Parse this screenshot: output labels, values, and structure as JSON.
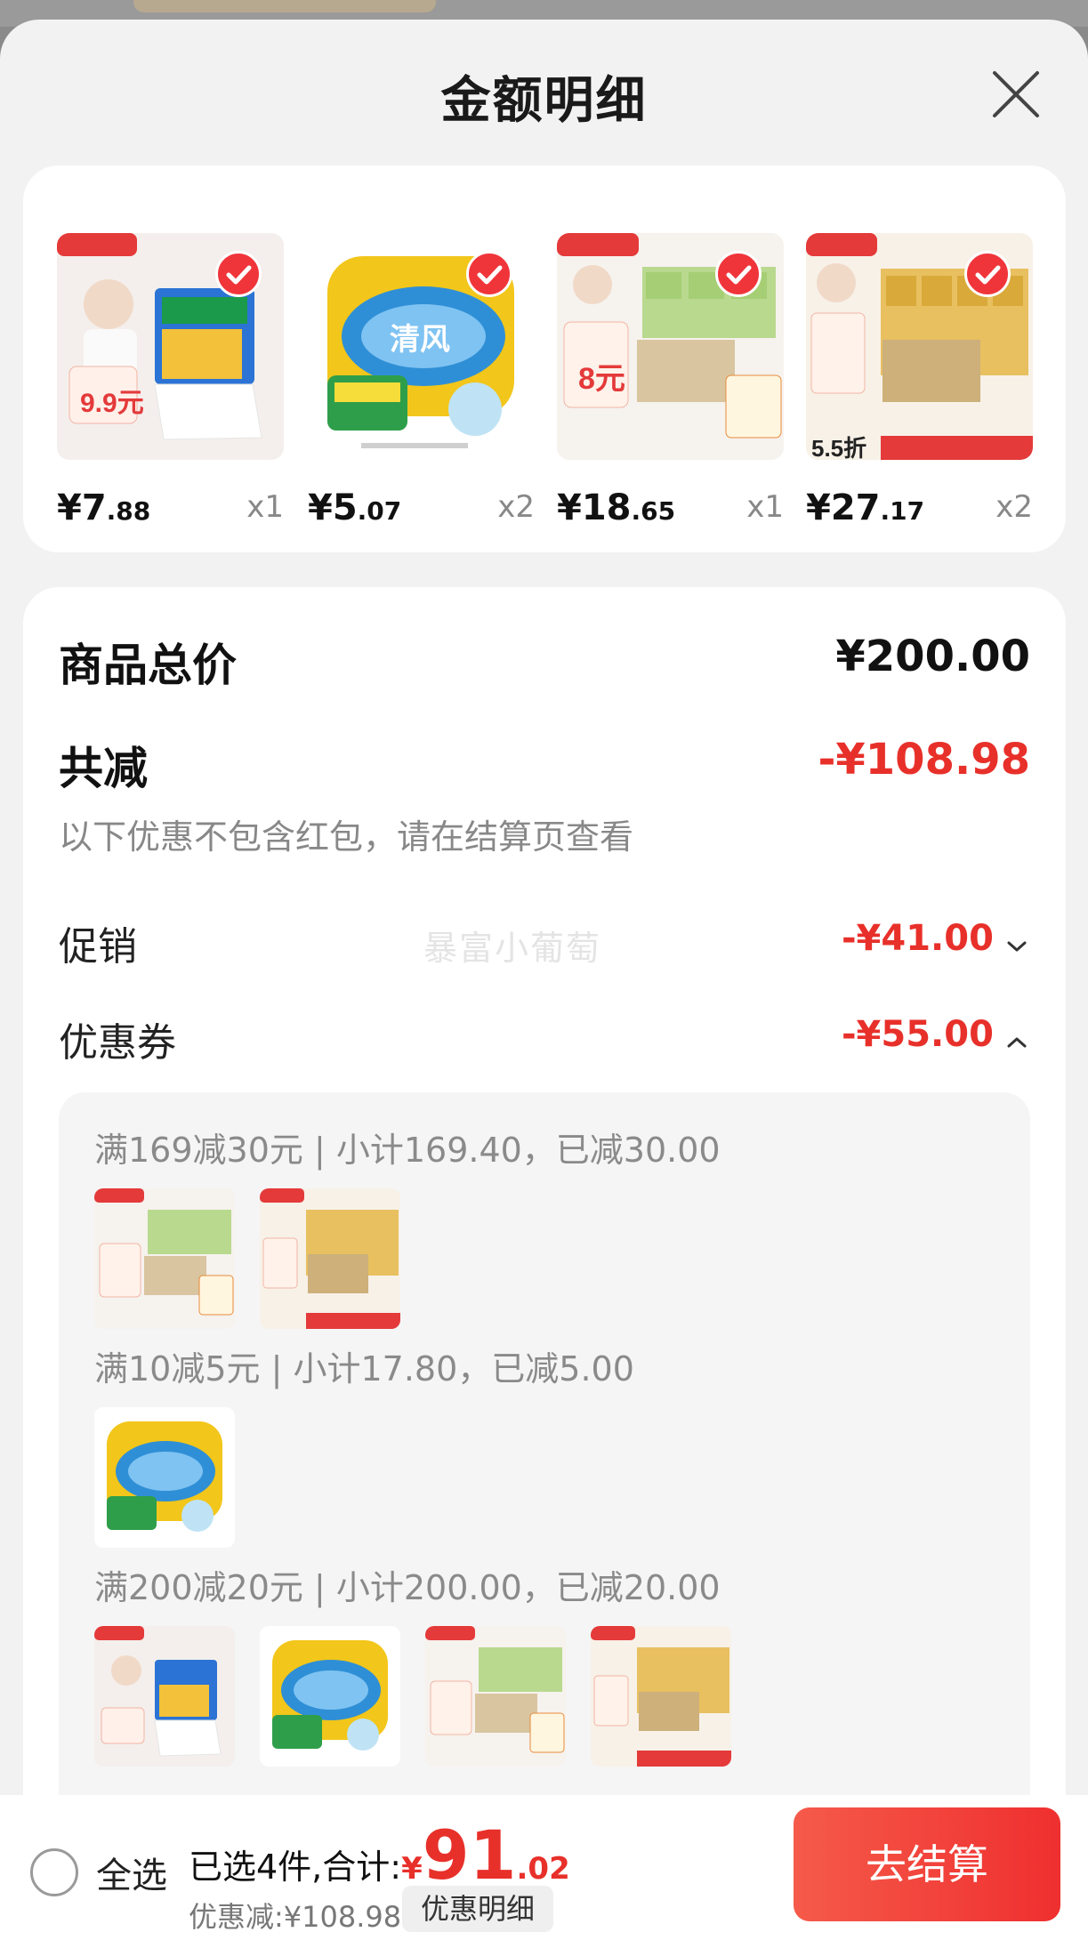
{
  "sheet": {
    "title": "金额明细",
    "close_icon": "close-icon"
  },
  "products": [
    {
      "price_int": "¥7",
      "price_dec": ".88",
      "qty": "x1",
      "checked": true,
      "image": "kitchen-towel-bag-photo",
      "badge_text": "9.9元"
    },
    {
      "price_int": "¥5",
      "price_dec": ".07",
      "qty": "x2",
      "checked": true,
      "image": "kitchen-paper-roll-photo",
      "badge_text": "清风"
    },
    {
      "price_int": "¥18",
      "price_dec": ".65",
      "qty": "x1",
      "checked": true,
      "image": "green-tissue-pack-photo",
      "badge_text": "8元"
    },
    {
      "price_int": "¥27",
      "price_dec": ".17",
      "qty": "x2",
      "checked": true,
      "image": "yellow-tissue-pack-photo",
      "badge_text": "5.5折"
    }
  ],
  "summary": {
    "total_label": "商品总价",
    "total_value": "¥200.00",
    "reduce_label": "共减",
    "reduce_value": "-¥108.98",
    "reduce_note": "以下优惠不包含红包，请在结算页查看",
    "promo_label": "促销",
    "promo_value": "-¥41.00",
    "coupon_label": "优惠券",
    "coupon_value": "-¥55.00",
    "watermark": "暴富小葡萄"
  },
  "coupon_groups": [
    {
      "rule": "满169减30元 | 小计169.40，已减30.00",
      "items": [
        "green-tissue-pack-photo",
        "yellow-tissue-pack-photo"
      ]
    },
    {
      "rule": "满10减5元 | 小计17.80，已减5.00",
      "items": [
        "kitchen-paper-roll-photo"
      ]
    },
    {
      "rule": "满200减20元 | 小计200.00，已减20.00",
      "items": [
        "kitchen-towel-bag-photo",
        "kitchen-paper-roll-photo",
        "green-tissue-pack-photo",
        "yellow-tissue-pack-photo"
      ]
    }
  ],
  "bottom_bar": {
    "select_all": "全选",
    "selected_text": "已选4件,合计:",
    "currency": "¥",
    "total_int": "91",
    "total_dec": ".02",
    "discount_text": "优惠减:¥108.98",
    "detail_button": "优惠明细",
    "checkout_button": "去结算"
  },
  "colors": {
    "accent_red": "#e8302a",
    "checkout_gradient_start": "#f55a4a",
    "checkout_gradient_end": "#ef2f2f",
    "sheet_bg": "#f2f2f2",
    "card_bg": "#ffffff"
  }
}
